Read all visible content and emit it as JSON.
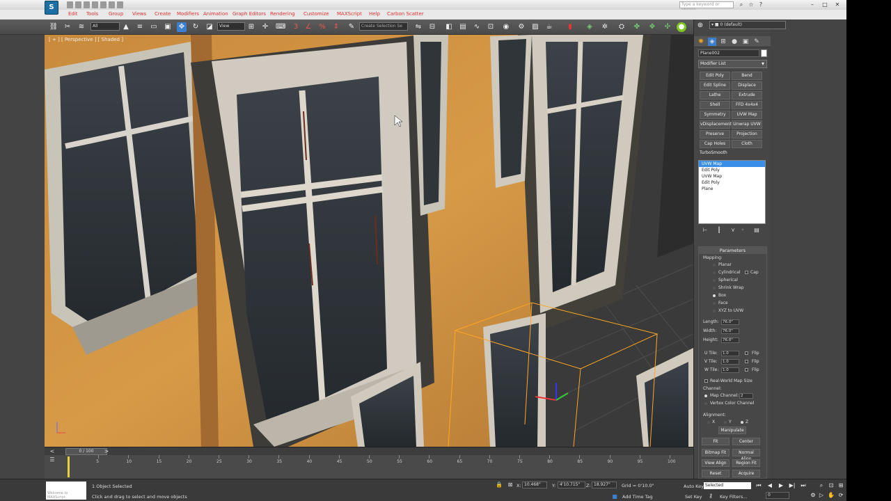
{
  "title_bar": {
    "app_logo_letter": "S",
    "window_title": "",
    "search_placeholder": "Type a keyword or phrase"
  },
  "menu": [
    "Edit",
    "Tools",
    "Group",
    "Views",
    "Create",
    "Modifiers",
    "Animation",
    "Graph Editors",
    "Rendering",
    "Customize",
    "MAXScript",
    "Help",
    "Carbon Scatter"
  ],
  "toolbar": {
    "selection_filter": "All",
    "reference_coord": "View",
    "named_selection": "Create Selection Se"
  },
  "viewport": {
    "label": "[ + ] [ Perspective ] [ Shaded ]"
  },
  "command_panel": {
    "object_name": "Plane002",
    "modifier_list_label": "Modifier List",
    "modifier_buttons": [
      [
        "Edit Poly",
        "Bend"
      ],
      [
        "Edit Spline",
        "Displace"
      ],
      [
        "Lathe",
        "Extrude"
      ],
      [
        "Shell",
        "FFD 4x4x4"
      ],
      [
        "Symmetry",
        "UVW Map"
      ],
      [
        "vDisplacement",
        "Unwrap UVW"
      ],
      [
        "Preserve",
        "Projection"
      ],
      [
        "Cap Holes",
        "Cloth"
      ],
      [
        "TurboSmooth",
        ""
      ]
    ],
    "stack": [
      {
        "label": "UVW Map",
        "selected": true
      },
      {
        "label": "Edit Poly",
        "selected": false
      },
      {
        "label": "UVW Map",
        "selected": false
      },
      {
        "label": "Edit Poly",
        "selected": false
      },
      {
        "label": "Plane",
        "selected": false
      }
    ],
    "parameters": {
      "header": "Parameters",
      "mapping_label": "Mapping:",
      "mapping_options": [
        "Planar",
        "Cylindrical",
        "Spherical",
        "Shrink Wrap",
        "Box",
        "Face",
        "XYZ to UVW"
      ],
      "mapping_selected": "Box",
      "cap_label": "Cap",
      "length_label": "Length:",
      "length_value": "76.0\"",
      "width_label": "Width:",
      "width_value": "76.0\"",
      "height_label": "Height:",
      "height_value": "76.0\"",
      "u_tile_label": "U Tile:",
      "u_tile_value": "1.0",
      "v_tile_label": "V Tile:",
      "v_tile_value": "1.0",
      "w_tile_label": "W Tile:",
      "w_tile_value": "1.0",
      "flip_label": "Flip",
      "real_world_label": "Real-World Map Size",
      "channel_label": "Channel:",
      "map_channel_label": "Map Channel:",
      "map_channel_value": "2",
      "vertex_color_label": "Vertex Color Channel",
      "alignment_label": "Alignment:",
      "axis_x": "X",
      "axis_y": "Y",
      "axis_z": "Z",
      "manipulate": "Manipulate",
      "buttons": [
        [
          "Fit",
          "Center"
        ],
        [
          "Bitmap Fit",
          "Normal Align"
        ],
        [
          "View Align",
          "Region Fit"
        ],
        [
          "Reset",
          "Acquire"
        ]
      ]
    }
  },
  "timeline": {
    "slider_text": "0 / 100",
    "ticks": [
      "5",
      "10",
      "15",
      "20",
      "25",
      "30",
      "35",
      "40",
      "45",
      "50",
      "55",
      "60",
      "65",
      "70",
      "75",
      "80",
      "85",
      "90",
      "95",
      "100"
    ],
    "current_frame": 0
  },
  "status": {
    "listener_text": "Welcome to MAXScript.",
    "selection_text": "1 Object Selected",
    "prompt_text": "Click and drag to select and move objects",
    "x_label": "X:",
    "x_value": "10.468\"",
    "y_label": "Y:",
    "y_value": "4'10.715\"",
    "z_label": "Z:",
    "z_value": "18.927\"",
    "grid_text": "Grid = 0'10.0\"",
    "add_time_tag": "Add Time Tag",
    "auto_key": "Auto Key",
    "set_key": "Set Key",
    "selected_value": "Selected",
    "key_filters": "Key Filters...",
    "frame_value": "0"
  }
}
